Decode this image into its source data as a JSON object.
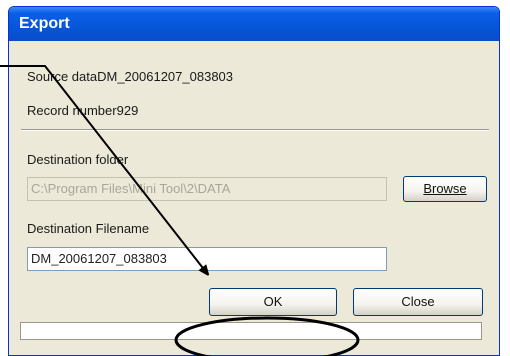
{
  "dialog": {
    "title": "Export",
    "source_label": "Source data",
    "source_value": "DM_20061207_083803",
    "record_label": "Record number",
    "record_value": "929",
    "dest_folder_label": "Destination folder",
    "dest_folder_value": "C:\\Program Files\\Mini Tool\\2\\DATA",
    "browse_label": "Browse",
    "dest_filename_label": "Destination Filename",
    "dest_filename_value": "DM_20061207_083803",
    "ok_label": "OK",
    "close_label": "Close"
  },
  "annotations": {
    "stroke_color": "#000000"
  }
}
